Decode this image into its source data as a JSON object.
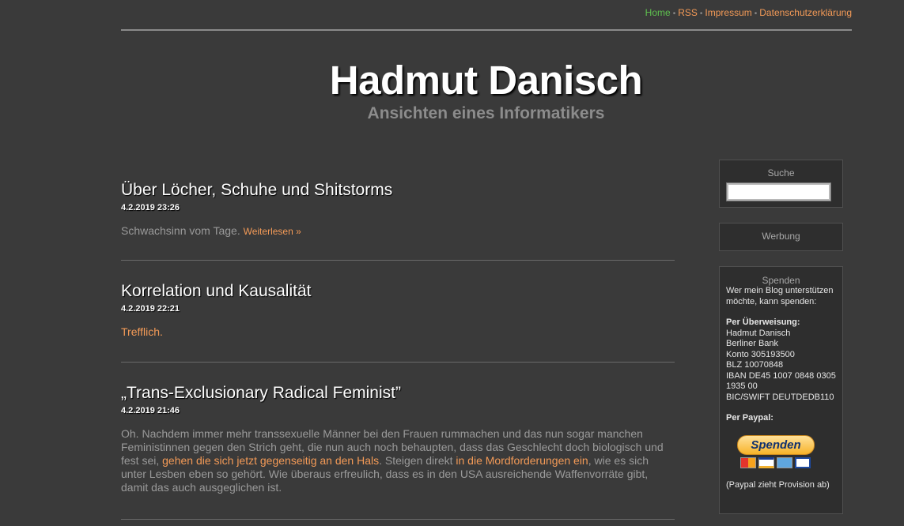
{
  "nav": {
    "home": "Home",
    "rss": "RSS",
    "impressum": "Impressum",
    "datenschutz": "Datenschutzerklärung",
    "separator": "•"
  },
  "site": {
    "title": "Hadmut Danisch",
    "subtitle": "Ansichten eines Informatikers"
  },
  "posts": [
    {
      "title": "Über Löcher, Schuhe und Shitstorms",
      "date": "4.2.2019 23:26",
      "text": "Schwachsinn vom Tage.",
      "more": "Weiterlesen »"
    },
    {
      "title": "Korrelation und Kausalität",
      "date": "4.2.2019 22:21",
      "link": "Trefflich."
    },
    {
      "title": "„Trans-Exclusionary Radical Feminist”",
      "date": "4.2.2019 21:46",
      "t1": "Oh. Nachdem immer mehr transsexuelle Männer bei den Frauen rummachen und das nun sogar manchen Feministinnen gegen den Strich geht, die nun auch noch behaupten, dass das Geschlecht doch biologisch und fest sei, ",
      "l1": "gehen die sich jetzt gegenseitig an den Hals",
      "t2": ". Steigen direkt ",
      "l2": "in die Mordforderungen ein",
      "t3": ", wie es sich unter Lesben eben so gehört. Wie überaus erfreulich, dass es in den USA ausreichende Waffenvorräte gibt, damit das auch ausgeglichen ist."
    }
  ],
  "sidebar": {
    "search_title": "Suche",
    "ads_title": "Werbung",
    "donate_title": "Spenden",
    "donate_intro": "Wer mein Blog unterstützen möchte, kann spenden:",
    "transfer_label": "Per Überweisung:",
    "bank_name": "Hadmut Danisch",
    "bank": "Berliner Bank",
    "konto": "Konto 305193500",
    "blz": "BLZ 10070848",
    "iban_line1": "IBAN DE45 1007 0848 0305",
    "iban_line2": "1935 00",
    "bic": "BIC/SWIFT DEUTDEDB110",
    "paypal_label": "Per Paypal:",
    "paypal_button": "Spenden",
    "paypal_note": "(Paypal zieht Provision ab)",
    "cards": [
      "mastercard",
      "visa",
      "amex",
      "ec"
    ]
  },
  "colors": {
    "background": "#3a3a3a",
    "link": "#f39a57",
    "home": "#5fc14f"
  }
}
